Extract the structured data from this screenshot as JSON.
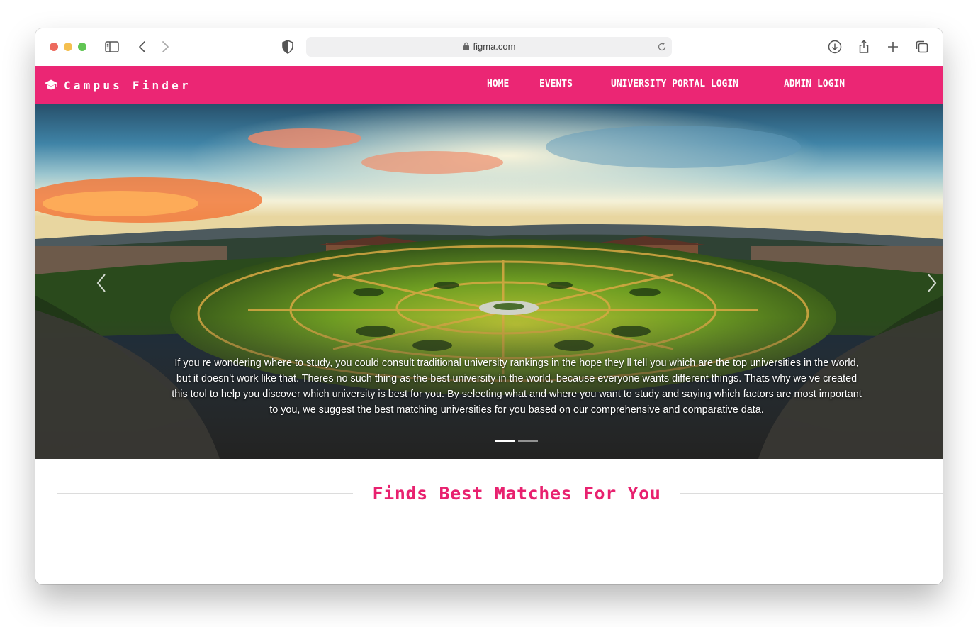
{
  "browser": {
    "url": "figma.com",
    "icons": [
      "sidebar-icon",
      "back-icon",
      "forward-icon",
      "shield-icon",
      "lock-icon",
      "reload-icon",
      "download-icon",
      "share-icon",
      "new-tab-icon",
      "tabs-overview-icon"
    ]
  },
  "navbar": {
    "brand": "Campus Finder",
    "brand_icon": "graduation-cap-icon",
    "links": {
      "home": "HOME",
      "events": "EVENTS",
      "portal": "UNIVERSITY PORTAL LOGIN",
      "admin": "ADMIN LOGIN"
    },
    "color": "#eb2674"
  },
  "hero": {
    "caption": "If you re wondering where to study, you could consult traditional university rankings in the hope they ll tell you which are the top universities in the world, but it doesn't work like that. Theres no such thing as the best university in the world, because everyone wants different things. Thats why we ve created this tool to help you discover which university is best for you. By selecting what and where you want to study and saying which factors are most important to you, we suggest the best matching universities for you based on our comprehensive and comparative data.",
    "slide_count": 2,
    "active_slide": 1,
    "icons": [
      "chevron-left-icon",
      "chevron-right-icon"
    ]
  },
  "section": {
    "heading": "Finds Best Matches For You",
    "color": "#e8216f"
  }
}
